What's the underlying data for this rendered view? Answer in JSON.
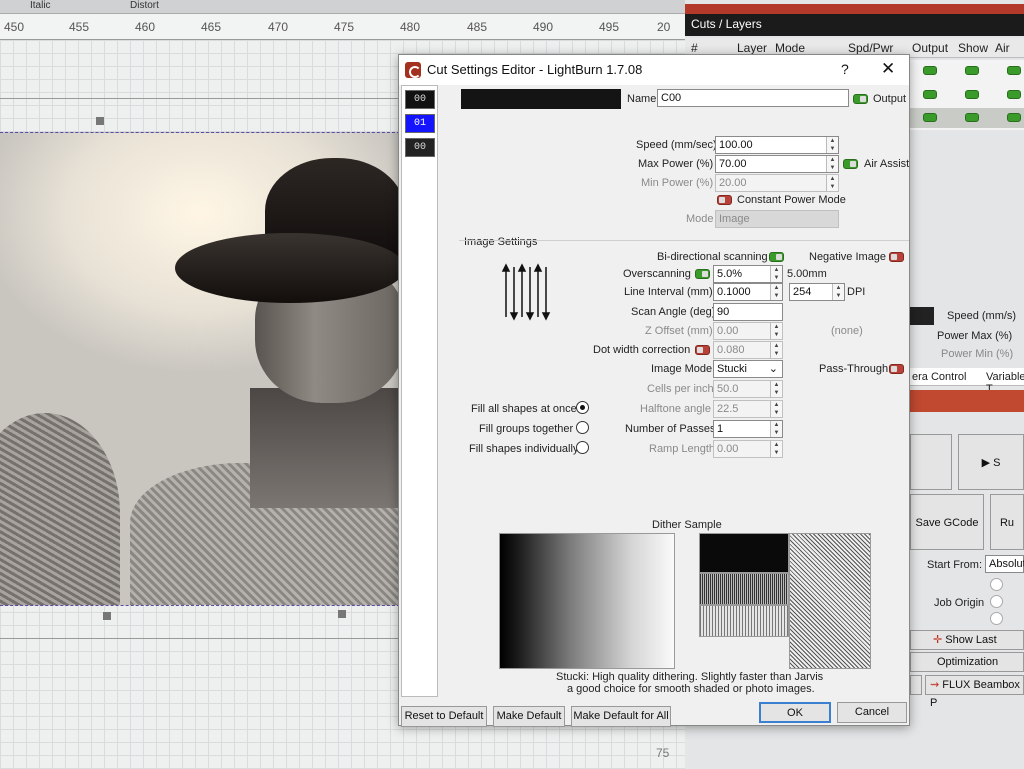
{
  "top_strip": {
    "italic": "Italic",
    "distort": "Distort"
  },
  "ruler": {
    "ticks": [
      "450",
      "455",
      "460",
      "465",
      "470",
      "475",
      "480",
      "485",
      "490",
      "495",
      "20"
    ],
    "bottom_value": "75"
  },
  "layers_panel": {
    "title": "Cuts / Layers",
    "columns": [
      "#",
      "Layer",
      "Mode",
      "Spd/Pwr",
      "Output",
      "Show",
      "Air"
    ],
    "speed_label": "Speed (mm/s)",
    "power_max_label": "Power Max (%)",
    "power_min_label": "Power Min (%)",
    "tabs": [
      "era Control",
      "Variable T"
    ],
    "save_gcode": "Save GCode",
    "start_label": "S",
    "run_label": "Ru",
    "start_from_label": "Start From:",
    "start_from_value": "Absolut",
    "job_origin_label": "Job Origin",
    "show_last_position": "Show Last Positi",
    "optimization_settings": "Optimization Settin",
    "device": "FLUX Beambox P"
  },
  "dialog": {
    "title": "Cut Settings Editor - LightBurn 1.7.08",
    "help": "?",
    "close": "✕",
    "layers": [
      "00",
      "01",
      "00"
    ],
    "name_label": "Name",
    "name_value": "C00",
    "output_label": "Output",
    "speed_label": "Speed (mm/sec)",
    "speed_value": "100.00",
    "max_power_label": "Max Power (%)",
    "max_power_value": "70.00",
    "air_assist_label": "Air Assist",
    "min_power_label": "Min Power (%)",
    "min_power_value": "20.00",
    "constant_power_label": "Constant Power Mode",
    "mode_label": "Mode",
    "mode_value": "Image",
    "image_settings_label": "Image Settings",
    "bidirectional_label": "Bi-directional scanning",
    "negative_label": "Negative Image",
    "overscanning_label": "Overscanning",
    "overscanning_value": "5.0%",
    "overscanning_mm": "5.00mm",
    "line_interval_label": "Line Interval (mm)",
    "line_interval_value": "0.1000",
    "dpi_value": "254",
    "dpi_label": "DPI",
    "scan_angle_label": "Scan Angle (deg)",
    "scan_angle_value": "90",
    "z_offset_label": "Z Offset (mm)",
    "z_offset_value": "0.00",
    "none_label": "(none)",
    "dot_width_label": "Dot width correction",
    "dot_width_value": "0.080",
    "image_mode_label": "Image Mode",
    "image_mode_value": "Stucki",
    "pass_through_label": "Pass-Through",
    "cells_label": "Cells per inch",
    "cells_value": "50.0",
    "halftone_label": "Halftone angle",
    "halftone_value": "22.5",
    "passes_label": "Number of Passes",
    "passes_value": "1",
    "ramp_label": "Ramp Length",
    "ramp_value": "0.00",
    "fill_all_label": "Fill all shapes at once",
    "fill_groups_label": "Fill groups together",
    "fill_individual_label": "Fill shapes individually",
    "dither_sample_label": "Dither Sample",
    "dither_desc_1": "Stucki: High quality dithering. Slightly faster than Jarvis",
    "dither_desc_2": "a good choice for smooth shaded or photo images.",
    "reset_button": "Reset to Default",
    "make_default_button": "Make Default",
    "make_default_all_button": "Make Default for All",
    "ok_button": "OK",
    "cancel_button": "Cancel"
  }
}
